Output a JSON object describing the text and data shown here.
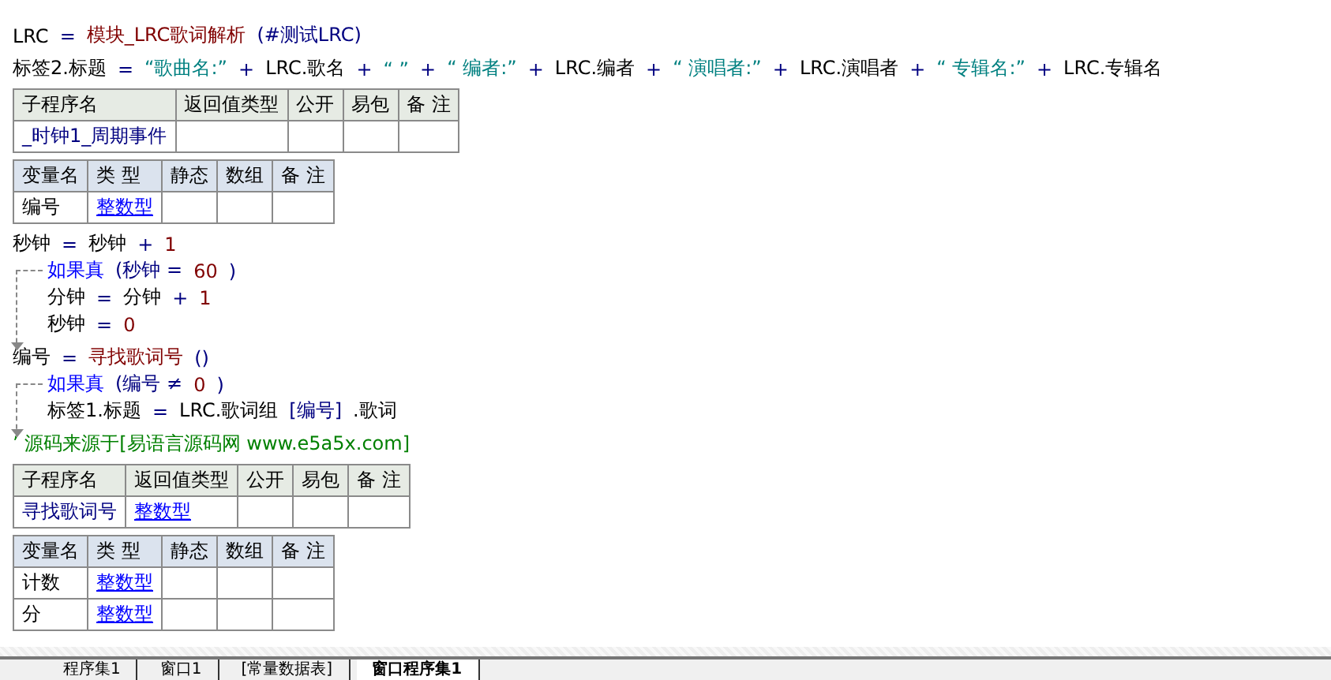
{
  "header_lines": [
    [
      {
        "kind": "ident",
        "text": "LRC"
      },
      {
        "kind": "op",
        "text": "="
      },
      {
        "kind": "func",
        "text": "模块_LRC歌词解析"
      },
      {
        "kind": "op",
        "text": "(#测试LRC)"
      }
    ],
    [
      {
        "kind": "ident",
        "text": "标签2.标题"
      },
      {
        "kind": "op",
        "text": "="
      },
      {
        "kind": "str",
        "text": "“歌曲名:”"
      },
      {
        "kind": "op",
        "text": "+"
      },
      {
        "kind": "ident",
        "text": "LRC.歌名"
      },
      {
        "kind": "op",
        "text": "+"
      },
      {
        "kind": "str",
        "text": "“ ”"
      },
      {
        "kind": "op",
        "text": "+"
      },
      {
        "kind": "str",
        "text": "“ 编者:”"
      },
      {
        "kind": "op",
        "text": "+"
      },
      {
        "kind": "ident",
        "text": "LRC.编者"
      },
      {
        "kind": "op",
        "text": "+"
      },
      {
        "kind": "str",
        "text": "“ 演唱者:”"
      },
      {
        "kind": "op",
        "text": "+"
      },
      {
        "kind": "ident",
        "text": "LRC.演唱者"
      },
      {
        "kind": "op",
        "text": "+"
      },
      {
        "kind": "str",
        "text": "“ 专辑名:”"
      },
      {
        "kind": "op",
        "text": "+"
      },
      {
        "kind": "ident",
        "text": "LRC.专辑名"
      }
    ]
  ],
  "blocks": [
    {
      "kind": "subroutine_table",
      "headers": [
        "子程序名",
        "返回值类型",
        "公开",
        "易包",
        "备 注"
      ],
      "rows": [
        [
          {
            "kind": "name",
            "text": "_时钟1_周期事件"
          },
          {
            "kind": "empty"
          },
          {
            "kind": "empty"
          },
          {
            "kind": "empty"
          },
          {
            "kind": "empty"
          }
        ]
      ]
    },
    {
      "kind": "variable_table",
      "headers": [
        "变量名",
        "类 型",
        "静态",
        "数组",
        "备 注"
      ],
      "rows": [
        [
          {
            "kind": "plain",
            "text": "编号"
          },
          {
            "kind": "type",
            "text": "整数型"
          },
          {
            "kind": "empty"
          },
          {
            "kind": "empty"
          },
          {
            "kind": "empty"
          }
        ]
      ]
    },
    {
      "kind": "code",
      "statements": [
        {
          "kind": "line",
          "tokens": [
            {
              "kind": "ident",
              "text": "秒钟"
            },
            {
              "kind": "op",
              "text": "="
            },
            {
              "kind": "ident",
              "text": "秒钟"
            },
            {
              "kind": "op",
              "text": "+"
            },
            {
              "kind": "num",
              "text": "1"
            }
          ]
        },
        {
          "kind": "if",
          "tokens": [
            {
              "kind": "keyword",
              "text": "如果真"
            },
            {
              "kind": "op",
              "text": "(秒钟 ="
            },
            {
              "kind": "num",
              "text": "60"
            },
            {
              "kind": "op",
              "text": ")"
            }
          ],
          "children": [
            {
              "kind": "line",
              "tokens": [
                {
                  "kind": "ident",
                  "text": "分钟"
                },
                {
                  "kind": "op",
                  "text": "="
                },
                {
                  "kind": "ident",
                  "text": "分钟"
                },
                {
                  "kind": "op",
                  "text": "+"
                },
                {
                  "kind": "num",
                  "text": "1"
                }
              ]
            },
            {
              "kind": "line",
              "tokens": [
                {
                  "kind": "ident",
                  "text": "秒钟"
                },
                {
                  "kind": "op",
                  "text": "="
                },
                {
                  "kind": "num",
                  "text": "0"
                }
              ]
            }
          ]
        },
        {
          "kind": "line",
          "tokens": [
            {
              "kind": "ident",
              "text": "编号"
            },
            {
              "kind": "op",
              "text": "="
            },
            {
              "kind": "func",
              "text": "寻找歌词号"
            },
            {
              "kind": "op",
              "text": "()"
            }
          ]
        },
        {
          "kind": "if",
          "tokens": [
            {
              "kind": "keyword",
              "text": "如果真"
            },
            {
              "kind": "op",
              "text": "(编号 ≠"
            },
            {
              "kind": "num",
              "text": "0"
            },
            {
              "kind": "op",
              "text": ")"
            }
          ],
          "children": [
            {
              "kind": "line",
              "tokens": [
                {
                  "kind": "ident",
                  "text": "标签1.标题"
                },
                {
                  "kind": "op",
                  "text": "="
                },
                {
                  "kind": "ident",
                  "text": "LRC.歌词组"
                },
                {
                  "kind": "op",
                  "text": "[编号]"
                },
                {
                  "kind": "ident",
                  "text": ".歌词"
                }
              ]
            }
          ]
        },
        {
          "kind": "comment",
          "tokens": [
            {
              "kind": "comment",
              "text": "’ 源码来源于[易语言源码网 www.e5a5x.com]"
            }
          ]
        }
      ]
    },
    {
      "kind": "subroutine_table",
      "headers": [
        "子程序名",
        "返回值类型",
        "公开",
        "易包",
        "备 注"
      ],
      "rows": [
        [
          {
            "kind": "name",
            "text": "寻找歌词号"
          },
          {
            "kind": "type",
            "text": "整数型"
          },
          {
            "kind": "empty"
          },
          {
            "kind": "empty"
          },
          {
            "kind": "empty"
          }
        ]
      ]
    },
    {
      "kind": "variable_table",
      "headers": [
        "变量名",
        "类 型",
        "静态",
        "数组",
        "备 注"
      ],
      "rows": [
        [
          {
            "kind": "plain",
            "text": "计数"
          },
          {
            "kind": "type",
            "text": "整数型"
          },
          {
            "kind": "empty"
          },
          {
            "kind": "empty"
          },
          {
            "kind": "empty"
          }
        ],
        [
          {
            "kind": "plain",
            "text": "分"
          },
          {
            "kind": "type",
            "text": "整数型"
          },
          {
            "kind": "empty"
          },
          {
            "kind": "empty"
          },
          {
            "kind": "empty"
          }
        ]
      ]
    }
  ],
  "tabs": [
    {
      "label": "程序集1",
      "selected": false
    },
    {
      "label": "窗口1",
      "selected": false
    },
    {
      "label": "[常量数据表]",
      "selected": false
    },
    {
      "label": "窗口程序集1",
      "selected": true
    }
  ]
}
